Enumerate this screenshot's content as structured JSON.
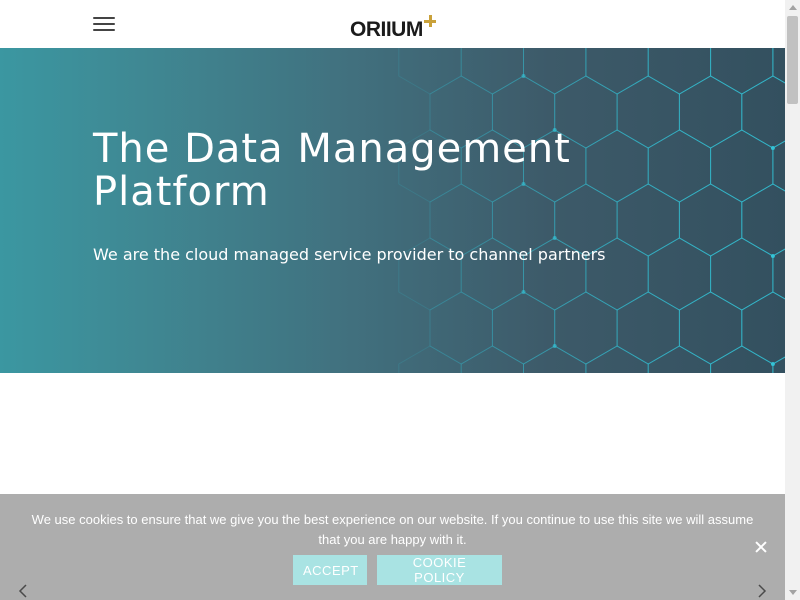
{
  "header": {
    "menu_icon": "hamburger-menu-icon",
    "logo_text": "ORIIUM"
  },
  "hero": {
    "title": "The Data Management Platform",
    "subtitle": "We are the cloud managed service provider to channel partners",
    "colors": {
      "gradient_start": "#3b97a1",
      "gradient_end": "#33505f",
      "pattern": "#34c8dc"
    }
  },
  "cookie_notice": {
    "text": "We use cookies to ensure that we give you the best experience on our website. If you continue to use this site we will assume that you are happy with it.",
    "accept_label": "ACCEPT",
    "policy_label": "COOKIE POLICY",
    "close_icon": "close-icon",
    "button_color": "#a9e3e3"
  },
  "slider": {
    "prev_icon": "chevron-left-icon",
    "next_icon": "chevron-right-icon"
  }
}
